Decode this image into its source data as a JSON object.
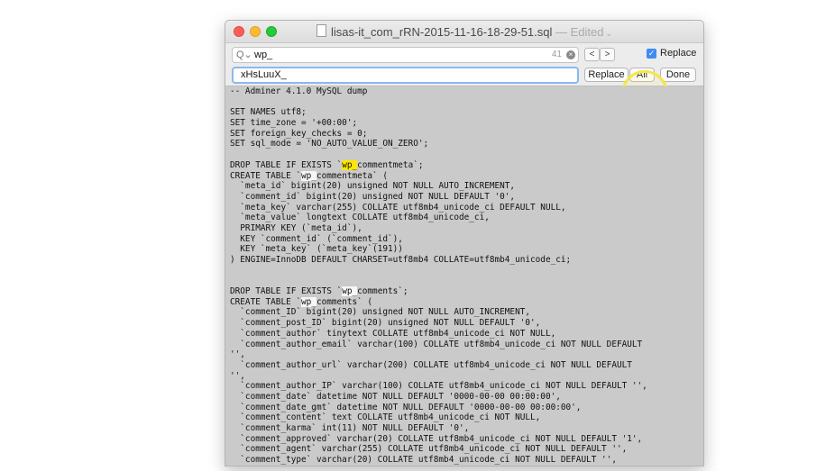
{
  "window": {
    "filename": "lisas-it_com_rRN-2015-11-16-18-29-51.sql",
    "edited": " — Edited"
  },
  "find": {
    "query": "wp_",
    "match_count": "41",
    "prev_label": "<",
    "next_label": ">",
    "replace_checked_label": "Replace",
    "replace_value": "xHsLuuX_",
    "replace_button": "Replace",
    "all_button": "All",
    "done_button": "Done"
  },
  "code_lines": [
    "-- Adminer 4.1.0 MySQL dump",
    "",
    "SET NAMES utf8;",
    "SET time_zone = '+00:00';",
    "SET foreign_key_checks = 0;",
    "SET sql_mode = 'NO_AUTO_VALUE_ON_ZERO';",
    "",
    "DROP TABLE IF EXISTS `wp_commentmeta`;",
    "CREATE TABLE `wp_commentmeta` (",
    "  `meta_id` bigint(20) unsigned NOT NULL AUTO_INCREMENT,",
    "  `comment_id` bigint(20) unsigned NOT NULL DEFAULT '0',",
    "  `meta_key` varchar(255) COLLATE utf8mb4_unicode_ci DEFAULT NULL,",
    "  `meta_value` longtext COLLATE utf8mb4_unicode_ci,",
    "  PRIMARY KEY (`meta_id`),",
    "  KEY `comment_id` (`comment_id`),",
    "  KEY `meta_key` (`meta_key`(191))",
    ") ENGINE=InnoDB DEFAULT CHARSET=utf8mb4 COLLATE=utf8mb4_unicode_ci;",
    "",
    "",
    "DROP TABLE IF EXISTS `wp_comments`;",
    "CREATE TABLE `wp_comments` (",
    "  `comment_ID` bigint(20) unsigned NOT NULL AUTO_INCREMENT,",
    "  `comment_post_ID` bigint(20) unsigned NOT NULL DEFAULT '0',",
    "  `comment_author` tinytext COLLATE utf8mb4_unicode_ci NOT NULL,",
    "  `comment_author_email` varchar(100) COLLATE utf8mb4_unicode_ci NOT NULL DEFAULT",
    "'',",
    "  `comment_author_url` varchar(200) COLLATE utf8mb4_unicode_ci NOT NULL DEFAULT",
    "'',",
    "  `comment_author_IP` varchar(100) COLLATE utf8mb4_unicode_ci NOT NULL DEFAULT '',",
    "  `comment_date` datetime NOT NULL DEFAULT '0000-00-00 00:00:00',",
    "  `comment_date_gmt` datetime NOT NULL DEFAULT '0000-00-00 00:00:00',",
    "  `comment_content` text COLLATE utf8mb4_unicode_ci NOT NULL,",
    "  `comment_karma` int(11) NOT NULL DEFAULT '0',",
    "  `comment_approved` varchar(20) COLLATE utf8mb4_unicode_ci NOT NULL DEFAULT '1',",
    "  `comment_agent` varchar(255) COLLATE utf8mb4_unicode_ci NOT NULL DEFAULT '',",
    "  `comment_type` varchar(20) COLLATE utf8mb4_unicode_ci NOT NULL DEFAULT '',"
  ],
  "colors": {
    "match_highlight": "#ffe700",
    "accent": "#3f8cf3",
    "editor_bg": "#cacaca"
  }
}
